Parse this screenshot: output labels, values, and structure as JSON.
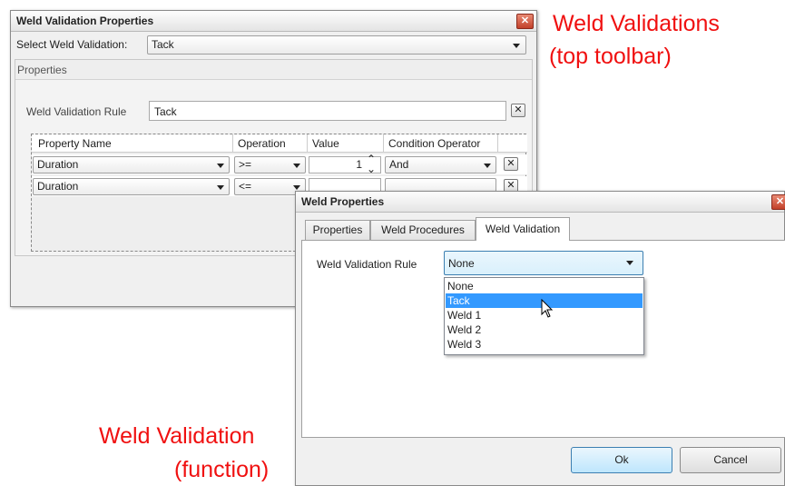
{
  "annotations": {
    "top_line1": "Weld Validations",
    "top_line2": "(top toolbar)",
    "bottom_line1": "Weld Validation",
    "bottom_line2": "(function)"
  },
  "validation_window": {
    "title": "Weld Validation Properties",
    "select_label": "Select Weld Validation:",
    "select_value": "Tack",
    "properties_header": "Properties",
    "rule_label": "Weld Validation Rule",
    "rule_value": "Tack",
    "columns": [
      "Property Name",
      "Operation",
      "Value",
      "Condition Operator"
    ],
    "rows": [
      {
        "property": "Duration",
        "operation": ">=",
        "value": "1",
        "condition": "And"
      },
      {
        "property": "Duration",
        "operation": "<=",
        "value": "",
        "condition": ""
      }
    ]
  },
  "properties_window": {
    "title": "Weld Properties",
    "tabs": [
      "Properties",
      "Weld Procedures",
      "Weld Validation"
    ],
    "active_tab": "Weld Validation",
    "rule_label": "Weld Validation Rule",
    "rule_value": "None",
    "options": [
      "None",
      "Tack",
      "Weld 1",
      "Weld 2",
      "Weld 3"
    ],
    "highlighted_option": "Tack",
    "ok_label": "Ok",
    "cancel_label": "Cancel"
  },
  "icons": {
    "close": "close-icon",
    "remove": "remove-row-icon",
    "dropdown": "chevron-down-icon",
    "spinner": "spinner-arrows-icon",
    "cursor": "mouse-pointer-icon"
  },
  "colors": {
    "annotation": "#f01010",
    "selection": "#3399ff",
    "focus_border": "#3c7fb1"
  }
}
